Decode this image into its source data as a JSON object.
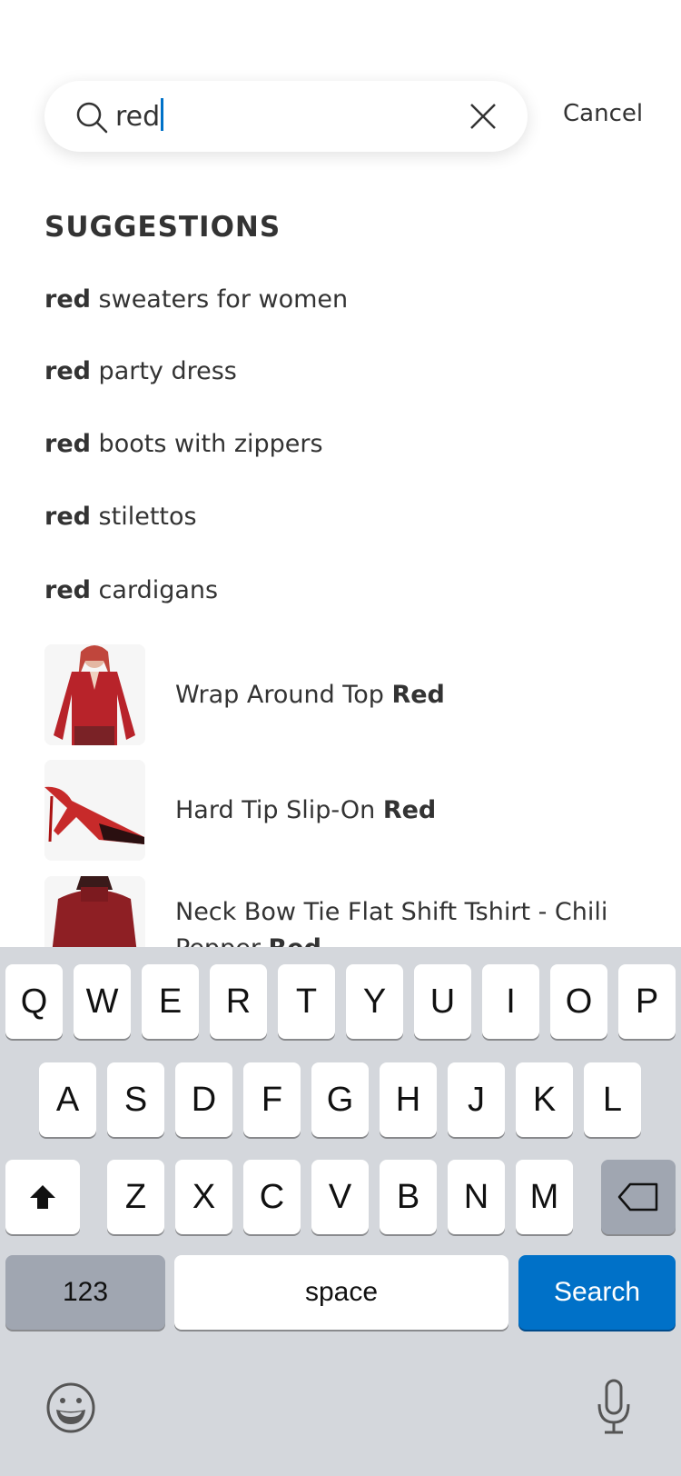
{
  "search": {
    "query": "red",
    "cancel_label": "Cancel"
  },
  "suggestions": {
    "heading": "SUGGESTIONS",
    "items": [
      {
        "bold": "red",
        "rest": " sweaters for women"
      },
      {
        "bold": "red",
        "rest": " party dress"
      },
      {
        "bold": "red",
        "rest": " boots with zippers"
      },
      {
        "bold": "red",
        "rest": " stilettos"
      },
      {
        "bold": "red",
        "rest": " cardigans"
      }
    ]
  },
  "products": [
    {
      "name": "Wrap Around Top ",
      "bold": "Red"
    },
    {
      "name": "Hard Tip Slip-On ",
      "bold": "Red"
    },
    {
      "name": "Neck Bow Tie Flat Shift Tshirt - Chili Pepper ",
      "bold": "Red"
    }
  ],
  "keyboard": {
    "rows": [
      [
        "Q",
        "W",
        "E",
        "R",
        "T",
        "Y",
        "U",
        "I",
        "O",
        "P"
      ],
      [
        "A",
        "S",
        "D",
        "F",
        "G",
        "H",
        "J",
        "K",
        "L"
      ],
      [
        "Z",
        "X",
        "C",
        "V",
        "B",
        "N",
        "M"
      ]
    ],
    "numbers_label": "123",
    "space_label": "space",
    "search_label": "Search",
    "accent": "#0071c8"
  }
}
